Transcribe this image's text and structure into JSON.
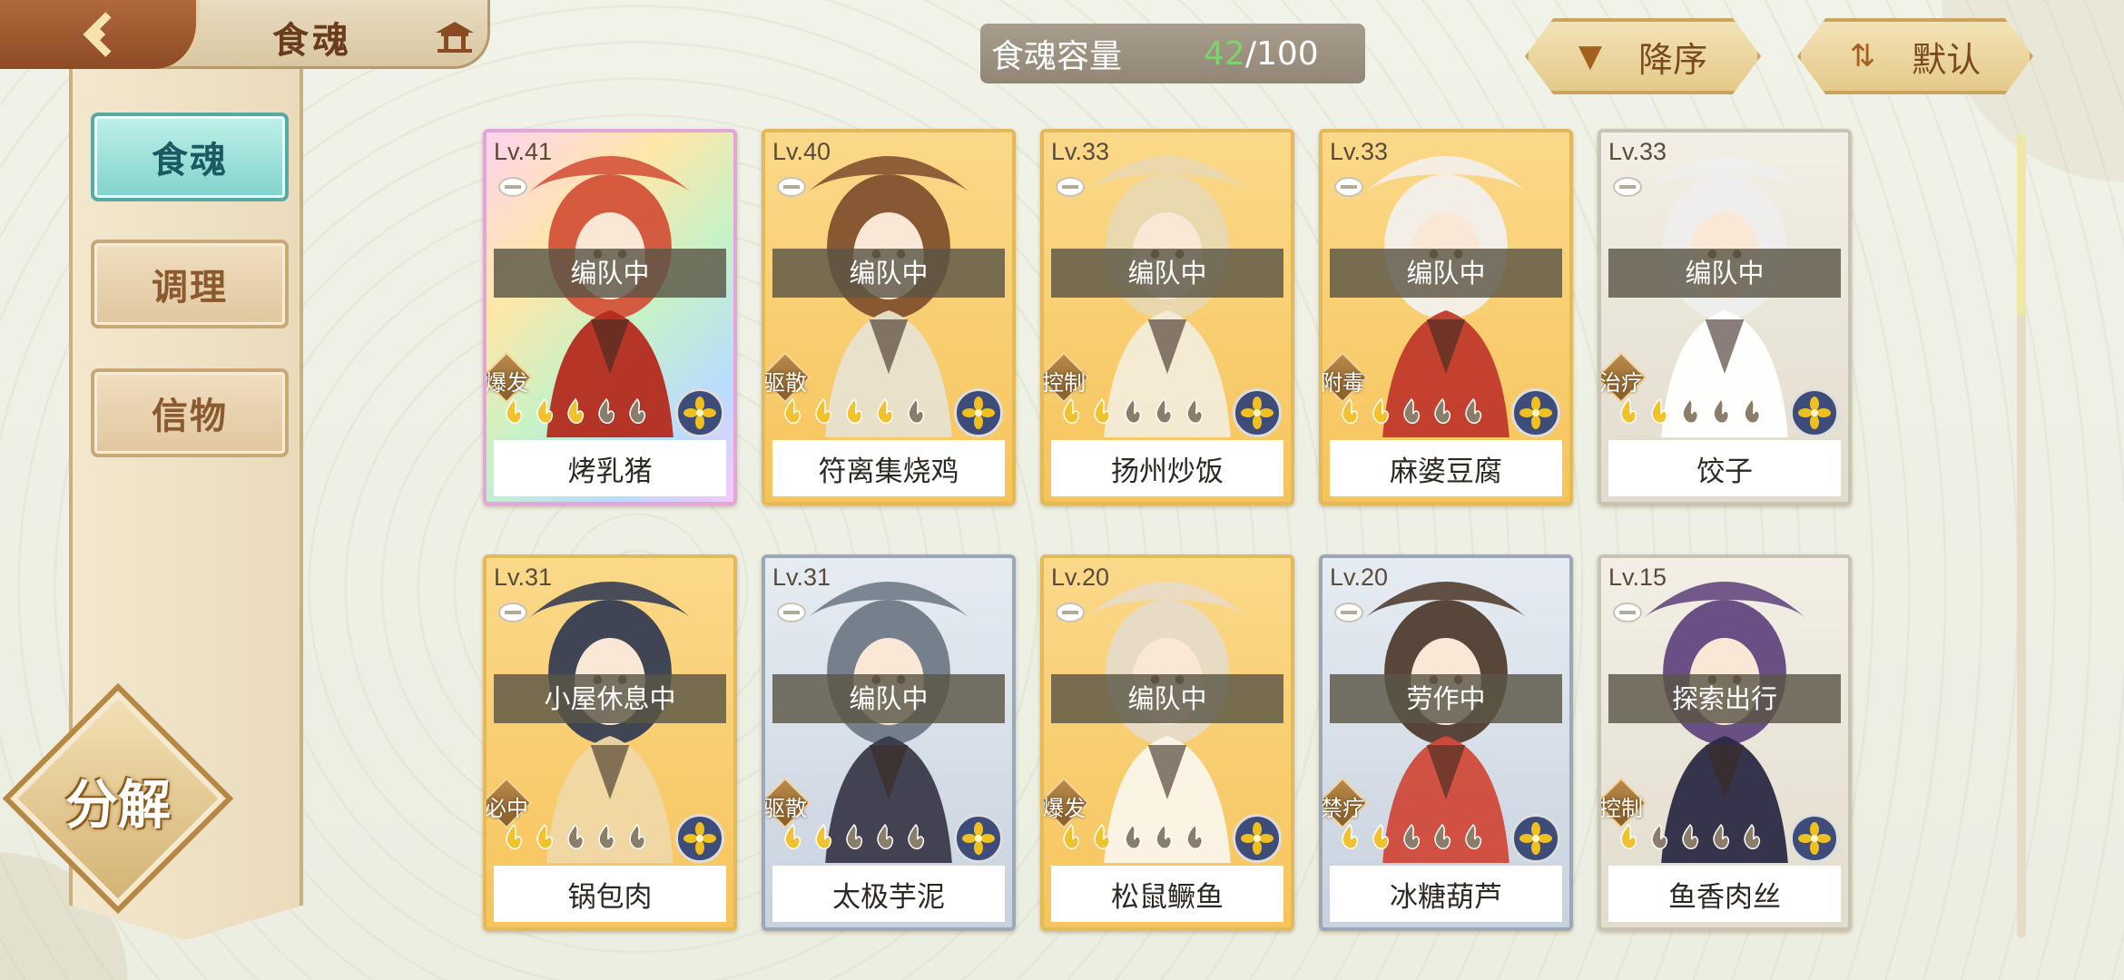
{
  "header": {
    "title": "食魂",
    "back_icon": "back-arrow-icon",
    "home_icon": "temple-icon"
  },
  "capacity": {
    "label": "食魂容量",
    "current": "42",
    "total": "/100"
  },
  "sort": {
    "order_label": "降序",
    "order_icon": "triangle-down-icon",
    "mode_label": "默认",
    "mode_icon": "sort-arrows-icon"
  },
  "sidebar": {
    "items": [
      {
        "label": "食魂",
        "active": true
      },
      {
        "label": "调理",
        "active": false
      },
      {
        "label": "信物",
        "active": false
      }
    ],
    "decompose_label": "分解"
  },
  "cards": [
    {
      "level": "Lv.41",
      "status": "编队中",
      "role": "爆发",
      "stars": 3,
      "element_color": "#f0c020",
      "name": "烤乳猪",
      "frame": "rainbow"
    },
    {
      "level": "Lv.40",
      "status": "编队中",
      "role": "驱散",
      "stars": 4,
      "element_color": "#f0c020",
      "name": "符离集烧鸡",
      "frame": "gold"
    },
    {
      "level": "Lv.33",
      "status": "编队中",
      "role": "控制",
      "stars": 2,
      "element_color": "#f0c020",
      "name": "扬州炒饭",
      "frame": "gold"
    },
    {
      "level": "Lv.33",
      "status": "编队中",
      "role": "附毒",
      "stars": 2,
      "element_color": "#f0c020",
      "name": "麻婆豆腐",
      "frame": "gold"
    },
    {
      "level": "Lv.33",
      "status": "编队中",
      "role": "治疗",
      "stars": 2,
      "element_color": "#f0c020",
      "name": "饺子",
      "frame": "white"
    },
    {
      "level": "Lv.31",
      "status": "小屋休息中",
      "role": "必中",
      "stars": 2,
      "element_color": "#f0c020",
      "name": "锅包肉",
      "frame": "gold"
    },
    {
      "level": "Lv.31",
      "status": "编队中",
      "role": "驱散",
      "stars": 2,
      "element_color": "#f0c020",
      "name": "太极芋泥",
      "frame": "silver"
    },
    {
      "level": "Lv.20",
      "status": "编队中",
      "role": "爆发",
      "stars": 2,
      "element_color": "#f0c020",
      "name": "松鼠鳜鱼",
      "frame": "gold"
    },
    {
      "level": "Lv.20",
      "status": "劳作中",
      "role": "禁疗",
      "stars": 2,
      "element_color": "#f0c020",
      "name": "冰糖葫芦",
      "frame": "silver"
    },
    {
      "level": "Lv.15",
      "status": "探索出行",
      "role": "控制",
      "stars": 1,
      "element_color": "#f0c020",
      "name": "鱼香肉丝",
      "frame": "white"
    }
  ]
}
